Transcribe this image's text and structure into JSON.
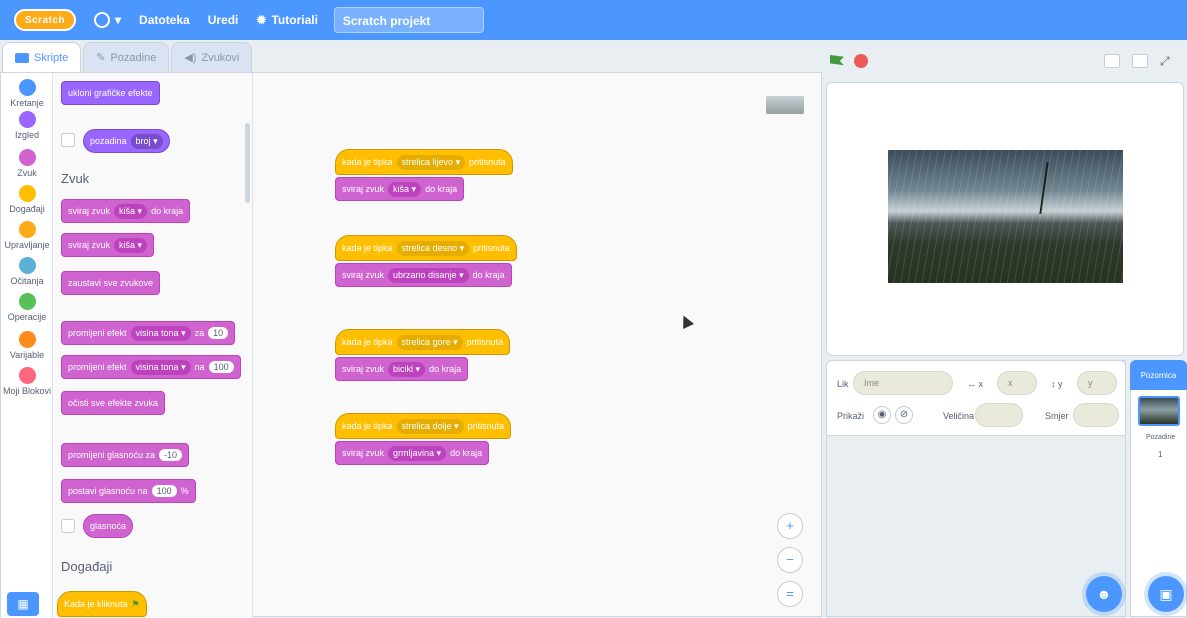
{
  "menubar": {
    "logo": "Scratch",
    "file": "Datoteka",
    "edit": "Uredi",
    "tutorials": "Tutoriali",
    "project_title": "Scratch projekt"
  },
  "tabs": [
    {
      "label": "Skripte"
    },
    {
      "label": "Pozadine"
    },
    {
      "label": "Zvukovi"
    }
  ],
  "categories": [
    {
      "label": "Kretanje",
      "color": "#4c97ff"
    },
    {
      "label": "Izgled",
      "color": "#9966ff"
    },
    {
      "label": "Zvuk",
      "color": "#cf63cf"
    },
    {
      "label": "Događaji",
      "color": "#ffbf00"
    },
    {
      "label": "Upravljanje",
      "color": "#ffab19"
    },
    {
      "label": "Očitanja",
      "color": "#5cb1d6"
    },
    {
      "label": "Operacije",
      "color": "#59c059"
    },
    {
      "label": "Varijable",
      "color": "#ff8c1a"
    },
    {
      "label": "Moji Blokovi",
      "color": "#ff6680"
    }
  ],
  "palette": {
    "clear_effects": "ukloni grafičke efekte",
    "backdrop_reporter": "pozadina",
    "backdrop_dd": "broj",
    "section_sound": "Zvuk",
    "play_until": {
      "text": "sviraj zvuk",
      "sound": "kiša",
      "suffix": "do kraja"
    },
    "start_sound": {
      "text": "sviraj zvuk",
      "sound": "kiša"
    },
    "stop_all": "zaustavi sve zvukove",
    "change_effect": {
      "text": "promijeni efekt",
      "effect": "visina tona",
      "by": "za",
      "value": "10"
    },
    "set_effect": {
      "text": "promijeni efekt",
      "effect": "visina tona",
      "to": "na",
      "value": "100"
    },
    "clear_sound_effects": "očisti sve efekte zvuka",
    "change_volume": {
      "text": "promijeni glasnoću za",
      "value": "-10"
    },
    "set_volume": {
      "text": "postavi glasnoću na",
      "value": "100",
      "unit": "%"
    },
    "volume_reporter": "glasnoća",
    "section_events": "Događaji",
    "when_flag": "Kada je kliknuta"
  },
  "scripts": [
    {
      "hat": {
        "prefix": "kada je tipka",
        "key": "strelica lijevo",
        "suffix": "pritisnuta"
      },
      "sound": {
        "text": "sviraj zvuk",
        "name": "kiša",
        "suffix": "do kraja"
      }
    },
    {
      "hat": {
        "prefix": "kada je tipka",
        "key": "strelica desno",
        "suffix": "pritisnuta"
      },
      "sound": {
        "text": "sviraj zvuk",
        "name": "ubrzano disanje",
        "suffix": "do kraja"
      }
    },
    {
      "hat": {
        "prefix": "kada je tipka",
        "key": "strelica gore",
        "suffix": "pritisnuta"
      },
      "sound": {
        "text": "sviraj zvuk",
        "name": "bicikl",
        "suffix": "do kraja"
      }
    },
    {
      "hat": {
        "prefix": "kada je tipka",
        "key": "strelica dolje",
        "suffix": "pritisnuta"
      },
      "sound": {
        "text": "sviraj zvuk",
        "name": "grmljavina",
        "suffix": "do kraja"
      }
    }
  ],
  "zoom": {
    "in": "+",
    "out": "−",
    "reset": "="
  },
  "sprite_info": {
    "sprite_label": "Lik",
    "sprite_name": "Ime",
    "x_label": "x",
    "x_value": "x",
    "y_label": "y",
    "y_value": "y",
    "show_label": "Prikaži",
    "size_label": "Veličina",
    "direction_label": "Smjer"
  },
  "backdrop": {
    "header": "Pozornica",
    "label": "Pozadine",
    "count": "1"
  }
}
